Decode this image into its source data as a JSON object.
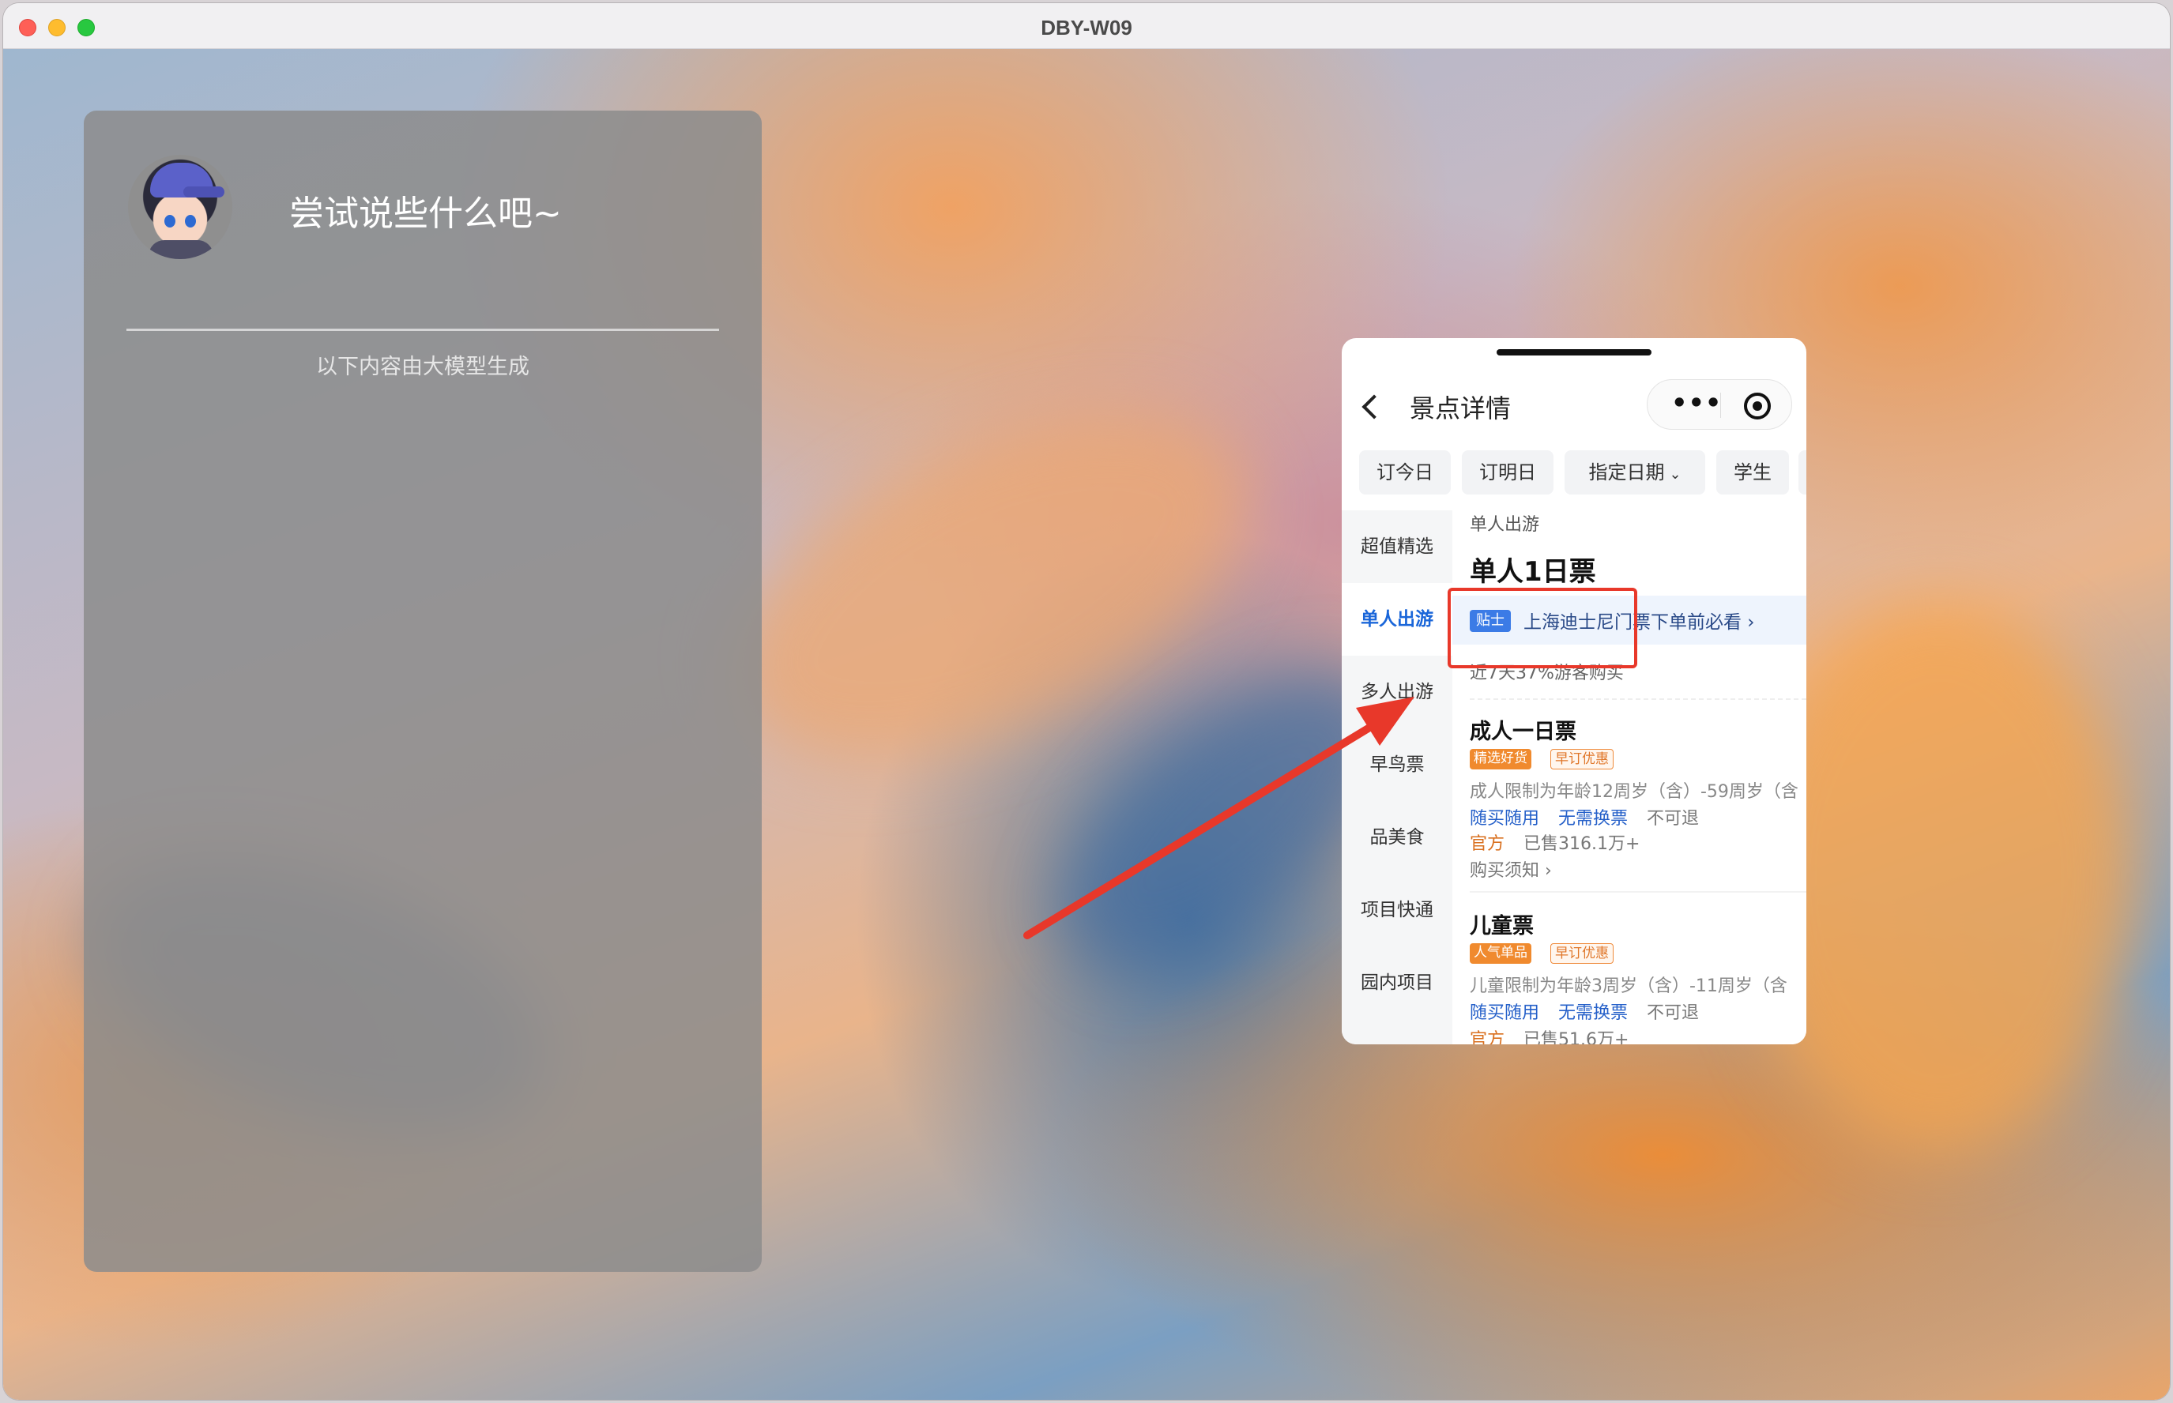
{
  "window": {
    "title": "DBY-W09"
  },
  "chat": {
    "prompt": "尝试说些什么吧~",
    "note": "以下内容由大模型生成"
  },
  "phone": {
    "nav_title": "景点详情",
    "capsule_more": "•••",
    "chips": [
      "订今日",
      "订明日",
      "指定日期",
      "学生"
    ],
    "chip_caret": "⌄",
    "side_items": [
      "超值精选",
      "单人出游",
      "多人出游",
      "早鸟票",
      "品美食",
      "项目快通",
      "园内项目"
    ],
    "active_side_index": 1,
    "section_label": "单人出游",
    "section_heading": "单人1日票",
    "tip_tag": "贴士",
    "tip_text": "上海迪士尼门票下单前必看 ›",
    "buy_stat": "近7天37%游客购买",
    "tickets": [
      {
        "title": "成人一日票",
        "badges": [
          "精选好货",
          "早订优惠"
        ],
        "desc": "成人限制为年龄12周岁（含）-59周岁（含",
        "features": [
          "随买随用",
          "无需换票",
          "不可退"
        ],
        "official": "官方",
        "sold": "已售316.1万+",
        "notice": "购买须知 ›"
      },
      {
        "title": "儿童票",
        "badges": [
          "人气单品",
          "早订优惠"
        ],
        "desc": "儿童限制为年龄3周岁（含）-11周岁（含",
        "features": [
          "随买随用",
          "无需换票",
          "不可退"
        ],
        "official": "官方",
        "sold": "已售51.6万+"
      }
    ]
  },
  "colors": {
    "highlight": "#e8382a",
    "accent_blue": "#1a66d9"
  }
}
